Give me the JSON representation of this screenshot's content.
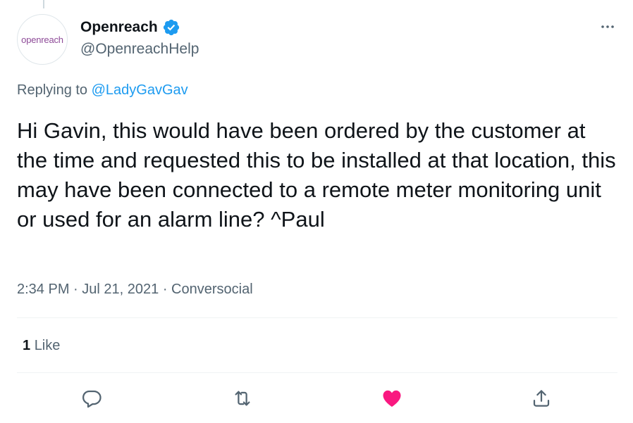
{
  "author": {
    "avatar_text": "openreach",
    "display_name": "Openreach",
    "handle": "@OpenreachHelp",
    "verified": true
  },
  "reply": {
    "prefix": "Replying to",
    "mention": "@LadyGavGav"
  },
  "tweet": {
    "text": "Hi Gavin, this would have been ordered by the customer at the time and requested this to be installed at that location, this may have been connected to a remote meter monitoring unit or used for an alarm line? ^Paul",
    "time": "2:34 PM",
    "date": "Jul 21, 2021",
    "source": "Conversocial"
  },
  "stats": {
    "like_count": "1",
    "like_label": "Like"
  },
  "actions": {
    "icons": [
      "reply-icon",
      "retweet-icon",
      "like-icon",
      "share-icon"
    ]
  },
  "colors": {
    "accent": "#1d9bf0",
    "like": "#f91880",
    "secondary_text": "#536471",
    "brand_purple": "#8e4b98"
  }
}
